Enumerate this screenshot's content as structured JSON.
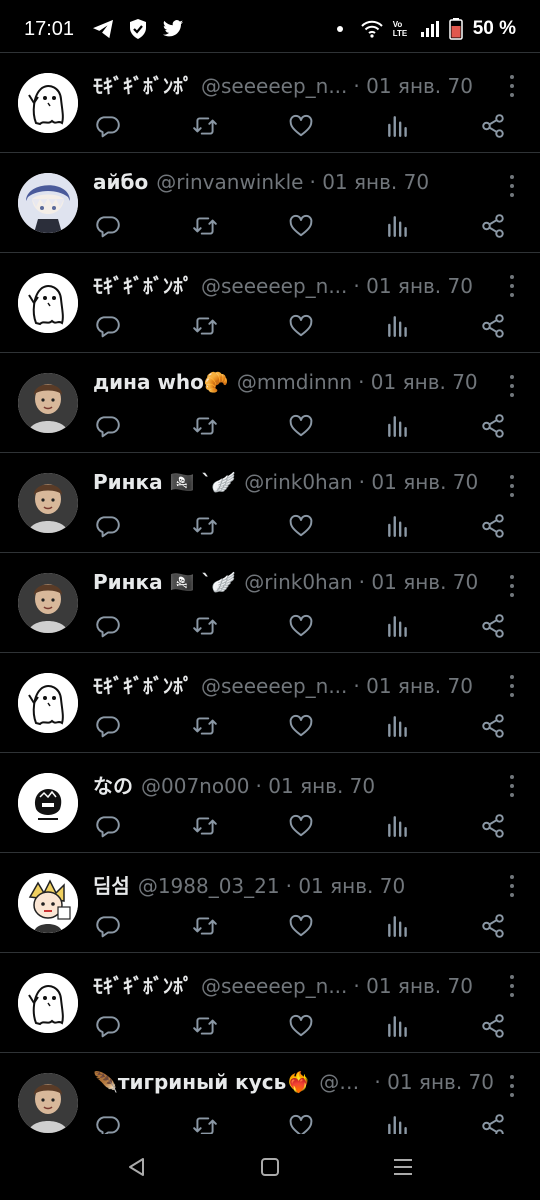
{
  "status": {
    "time": "17:01",
    "battery": "50 %",
    "volte": "Vo LTE"
  },
  "tweets": [
    {
      "name": "ﾓｷﾞｷﾞﾎﾞﾝﾎﾟ",
      "handle": "@seeeeep_n...",
      "date": "· 01 янв. 70",
      "avatar": "ghost-avatar"
    },
    {
      "name": "айбо",
      "handle": "@rinvanwinkle",
      "date": "· 01 янв. 70",
      "avatar": "anime-boy-avatar"
    },
    {
      "name": "ﾓｷﾞｷﾞﾎﾞﾝﾎﾟ",
      "handle": "@seeeeep_n...",
      "date": "· 01 янв. 70",
      "avatar": "ghost-avatar"
    },
    {
      "name": "дина who🥐",
      "handle": "@mmdinnn",
      "date": "· 01 янв. 70",
      "avatar": "photo-avatar"
    },
    {
      "name": "Ринка 🏴‍☠️ `🪽",
      "handle": "@rink0han",
      "date": "· 01 янв. 70",
      "avatar": "photo-avatar"
    },
    {
      "name": "Ринка 🏴‍☠️ `🪽",
      "handle": "@rink0han",
      "date": "· 01 янв. 70",
      "avatar": "photo-avatar"
    },
    {
      "name": "ﾓｷﾞｷﾞﾎﾞﾝﾎﾟ",
      "handle": "@seeeeep_n...",
      "date": "· 01 янв. 70",
      "avatar": "ghost-avatar"
    },
    {
      "name": "なの",
      "handle": "@007no00",
      "date": "· 01 янв. 70",
      "avatar": "sketch-avatar"
    },
    {
      "name": "딤섬",
      "handle": "@1988_03_21",
      "date": "· 01 янв. 70",
      "avatar": "cartoon-avatar"
    },
    {
      "name": "ﾓｷﾞｷﾞﾎﾞﾝﾎﾟ",
      "handle": "@seeeeep_n...",
      "date": "· 01 янв. 70",
      "avatar": "ghost-avatar"
    },
    {
      "name": "🪶тигриный кусь❤️‍🔥",
      "handle": "@n...",
      "date": "· 01 янв. 70",
      "avatar": "photo-avatar"
    }
  ],
  "colors": {
    "background": "#000000",
    "text": "#e7e9ea",
    "secondary": "#71767b",
    "divider": "#2f3336"
  }
}
